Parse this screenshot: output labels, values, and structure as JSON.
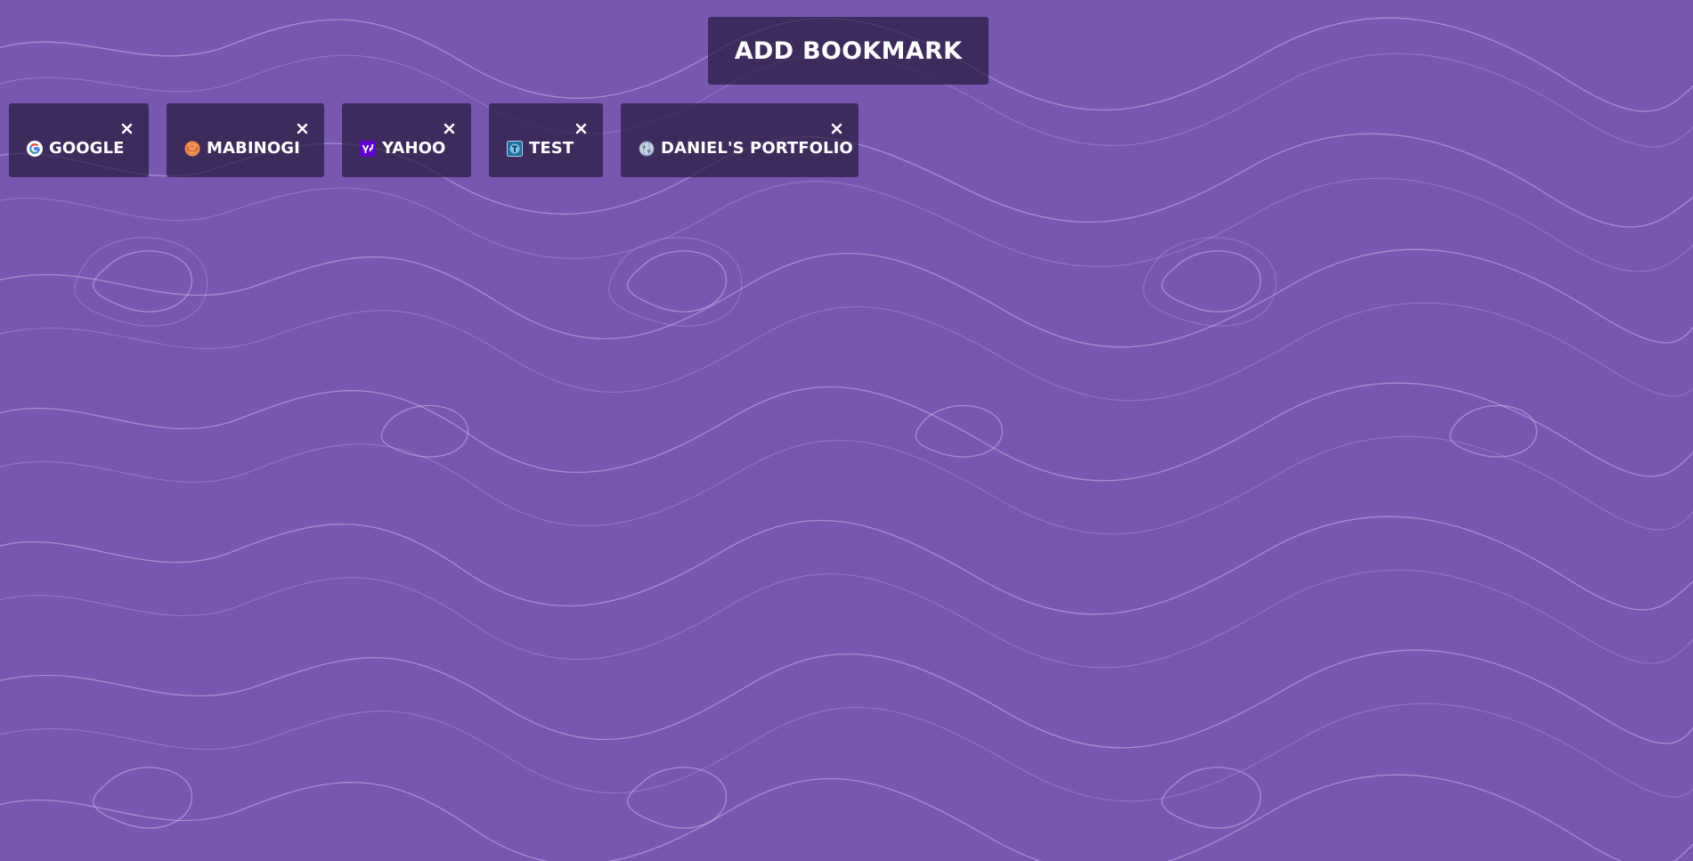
{
  "header": {
    "add_bookmark_label": "ADD BOOKMARK"
  },
  "bookmarks": [
    {
      "label": "GOOGLE",
      "icon": "google-icon",
      "remove_icon": "close-icon"
    },
    {
      "label": "MABINOGI",
      "icon": "mabinogi-icon",
      "remove_icon": "close-icon"
    },
    {
      "label": "YAHOO",
      "icon": "yahoo-icon",
      "remove_icon": "close-icon"
    },
    {
      "label": "TEST",
      "icon": "test-icon",
      "remove_icon": "close-icon"
    },
    {
      "label": "DANIEL'S PORTFOLIO",
      "icon": "globe-icon",
      "remove_icon": "close-icon"
    }
  ],
  "colors": {
    "background": "#7857b0",
    "card": "#281a3e",
    "text": "#ffffff",
    "contour": "#e6d7ff"
  }
}
